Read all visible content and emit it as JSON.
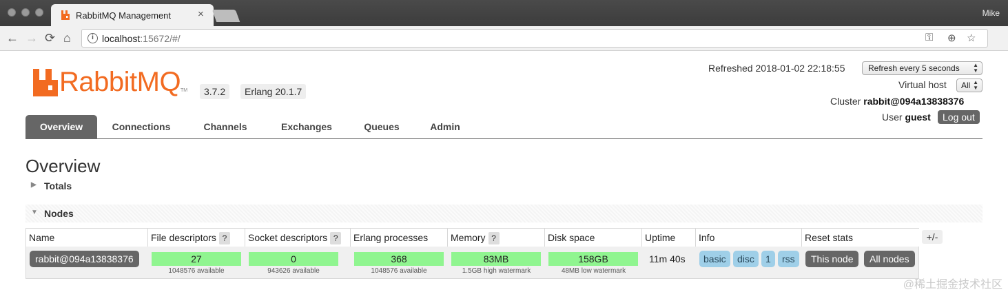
{
  "browser": {
    "tab_title": "RabbitMQ Management",
    "tab_close": "×",
    "profile_name": "Mike",
    "nav": {
      "back": "←",
      "forward": "→",
      "reload": "⟳",
      "home": "⌂"
    },
    "url_host": "localhost",
    "url_rest": ":15672/#/",
    "icons": {
      "key": "⚿",
      "zoom": "⊕",
      "star": "☆"
    },
    "info_glyph": "i"
  },
  "app": {
    "brand_color": "#f26b21",
    "logo_text": "RabbitMQ",
    "logo_tm": "TM",
    "version": "3.7.2",
    "erlang": "Erlang 20.1.7"
  },
  "status": {
    "refreshed_label": "Refreshed",
    "refreshed_time": "2018-01-02 22:18:55",
    "refresh_select": "Refresh every 5 seconds",
    "virtual_host_label": "Virtual host",
    "virtual_host_select": "All",
    "cluster_label": "Cluster",
    "cluster_name": "rabbit@094a13838376",
    "user_label": "User",
    "user_name": "guest",
    "logout": "Log out"
  },
  "tabs": [
    "Overview",
    "Connections",
    "Channels",
    "Exchanges",
    "Queues",
    "Admin"
  ],
  "page": {
    "title": "Overview",
    "sections": {
      "totals": "Totals",
      "nodes": "Nodes"
    },
    "triangles": {
      "collapsed": "▶",
      "expanded": "▼"
    }
  },
  "nodes_table": {
    "headers": {
      "name": "Name",
      "file_descriptors": "File descriptors",
      "socket_descriptors": "Socket descriptors",
      "erlang_processes": "Erlang processes",
      "memory": "Memory",
      "disk_space": "Disk space",
      "uptime": "Uptime",
      "info": "Info",
      "reset_stats": "Reset stats"
    },
    "help_glyph": "?",
    "row": {
      "name": "rabbit@094a13838376",
      "file_descriptors": {
        "value": "27",
        "sub": "1048576 available"
      },
      "socket_descriptors": {
        "value": "0",
        "sub": "943626 available"
      },
      "erlang_processes": {
        "value": "368",
        "sub": "1048576 available"
      },
      "memory": {
        "value": "83MB",
        "sub": "1.5GB high watermark"
      },
      "disk_space": {
        "value": "158GB",
        "sub": "48MB low watermark"
      },
      "uptime": "11m 40s",
      "info": [
        "basic",
        "disc",
        "1",
        "rss"
      ],
      "reset": {
        "this_node": "This node",
        "all_nodes": "All nodes"
      }
    },
    "columns_toggle": "+/-"
  },
  "watermark": "@稀土掘金技术社区"
}
